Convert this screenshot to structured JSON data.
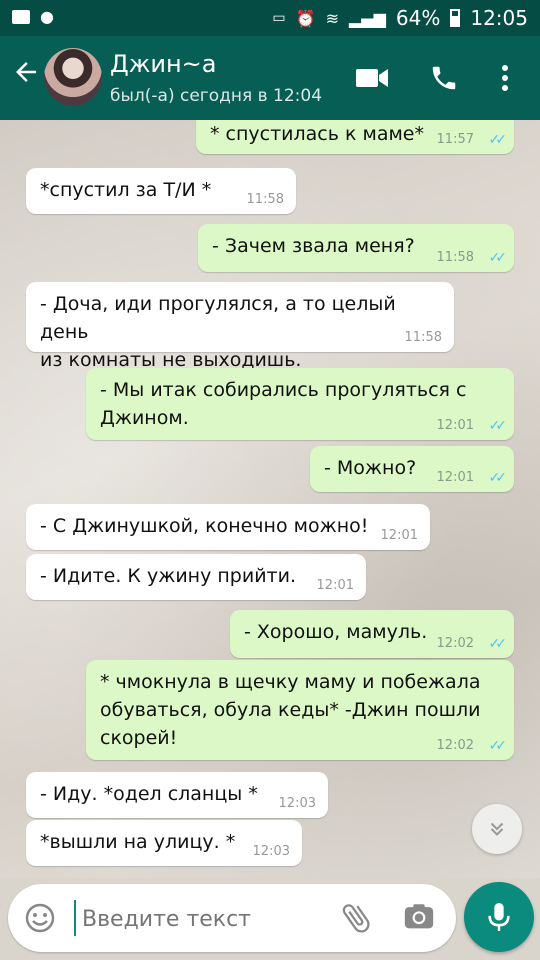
{
  "status_bar": {
    "battery": "64%",
    "time": "12:05"
  },
  "header": {
    "title": "Джин~а",
    "subtitle": "был(-а) сегодня в 12:04"
  },
  "messages": [
    {
      "direction": "out",
      "lines": [
        "* спустилась к маме*"
      ],
      "time": "11:57",
      "read": true
    },
    {
      "direction": "in",
      "lines": [
        "*спустил за Т/И *"
      ],
      "time": "11:58"
    },
    {
      "direction": "out",
      "lines": [
        "- Зачем звала меня?"
      ],
      "time": "11:58",
      "read": true
    },
    {
      "direction": "in",
      "lines": [
        "- Доча, иди прогулялся, а то целый день",
        "из комнаты не выходишь."
      ],
      "time": "11:58"
    },
    {
      "direction": "out",
      "lines": [
        "- Мы итак собирались прогуляться с",
        "Джином."
      ],
      "time": "12:01",
      "read": true
    },
    {
      "direction": "out",
      "lines": [
        "- Можно?"
      ],
      "time": "12:01",
      "read": true
    },
    {
      "direction": "in",
      "lines": [
        "- С Джинушкой, конечно можно!"
      ],
      "time": "12:01"
    },
    {
      "direction": "in",
      "lines": [
        "- Идите. К ужину прийти."
      ],
      "time": "12:01"
    },
    {
      "direction": "out",
      "lines": [
        "- Хорошо, мамуль."
      ],
      "time": "12:02",
      "read": true
    },
    {
      "direction": "out",
      "lines": [
        "* чмокнула в щечку маму и побежала",
        "обуваться, обула кеды* -Джин пошли",
        "скорей!"
      ],
      "time": "12:02",
      "read": true
    },
    {
      "direction": "in",
      "lines": [
        "- Иду. *одел сланцы *"
      ],
      "time": "12:03"
    },
    {
      "direction": "in",
      "lines": [
        "*вышли на улицу. *"
      ],
      "time": "12:03"
    }
  ],
  "input": {
    "placeholder": "Введите текст"
  },
  "icons": {
    "back": "arrow-left-icon",
    "video": "video-call-icon",
    "phone": "phone-icon",
    "more": "more-vertical-icon",
    "emoji": "emoji-icon",
    "attach": "paperclip-icon",
    "camera": "camera-icon",
    "mic": "microphone-icon",
    "scroll": "double-chevron-down-icon"
  },
  "colors": {
    "appbar": "#075e54",
    "statusbar": "#054d44",
    "outgoing": "#dcf8c6",
    "incoming": "#ffffff",
    "read_tick": "#4fc3f7",
    "mic": "#0b8a7e"
  }
}
